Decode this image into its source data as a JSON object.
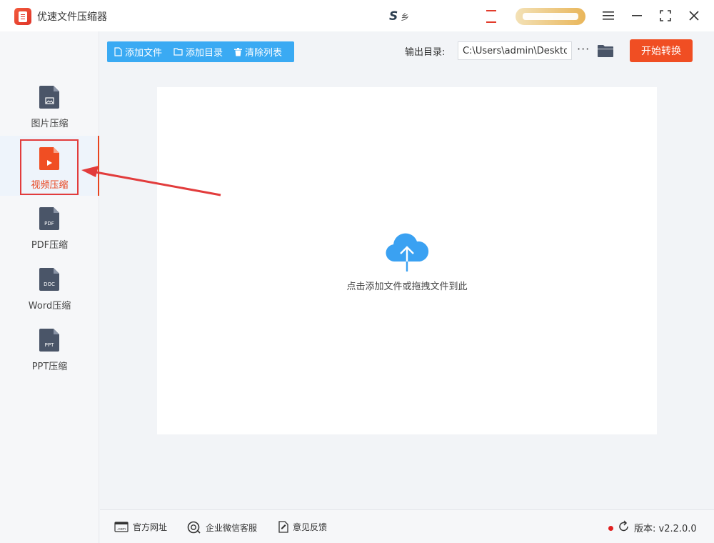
{
  "app": {
    "title": "优速文件压缩器"
  },
  "promo": {
    "logo_letter": "S",
    "small_text": "乡"
  },
  "sidebar": {
    "items": [
      {
        "label": "图片压缩",
        "icon": "image-file-icon",
        "color": "#4a5568",
        "active": false
      },
      {
        "label": "视频压缩",
        "icon": "video-file-icon",
        "color": "#f04e23",
        "active": true
      },
      {
        "label": "PDF压缩",
        "icon": "pdf-file-icon",
        "badge": "PDF",
        "color": "#4a5568",
        "active": false
      },
      {
        "label": "Word压缩",
        "icon": "doc-file-icon",
        "badge": "DOC",
        "color": "#4a5568",
        "active": false
      },
      {
        "label": "PPT压缩",
        "icon": "ppt-file-icon",
        "badge": "PPT",
        "color": "#4a5568",
        "active": false
      }
    ]
  },
  "toolbar": {
    "add_file": "添加文件",
    "add_dir": "添加目录",
    "clear_list": "清除列表",
    "output_label": "输出目录:",
    "output_path": "C:\\Users\\admin\\Desktop",
    "more": "···",
    "start": "开始转换"
  },
  "dropzone": {
    "hint": "点击添加文件或拖拽文件到此"
  },
  "footer": {
    "site": "官方网址",
    "site_icon_text": ".com",
    "wechat": "企业微信客服",
    "feedback": "意见反馈",
    "version": "版本: v2.2.0.0"
  },
  "colors": {
    "accent": "#f04e23",
    "primary": "#3aaaf3",
    "cloud": "#3aa1f2",
    "annotation": "#e23c3c"
  }
}
